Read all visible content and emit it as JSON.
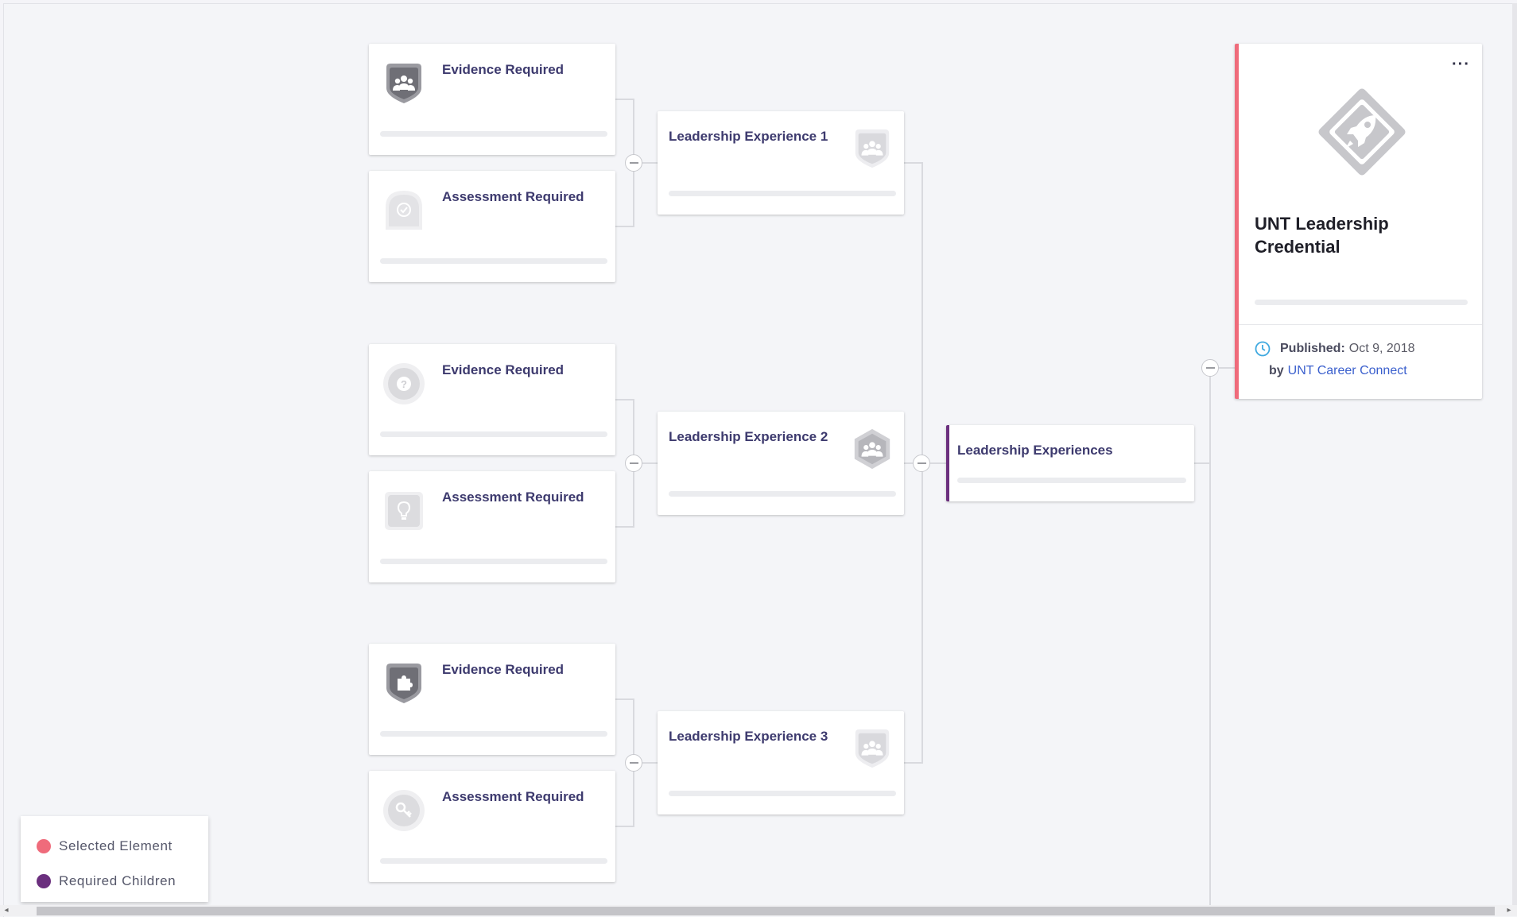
{
  "tree": {
    "groups": [
      {
        "children": [
          {
            "label": "Evidence Required",
            "icon": "group-shield-icon"
          },
          {
            "label": "Assessment Required",
            "icon": "check-arch-icon"
          }
        ],
        "experience": {
          "label": "Leadership Experience 1",
          "icon": "group-shield-icon"
        }
      },
      {
        "children": [
          {
            "label": "Evidence Required",
            "icon": "question-circle-icon"
          },
          {
            "label": "Assessment Required",
            "icon": "lightbulb-square-icon"
          }
        ],
        "experience": {
          "label": "Leadership Experience 2",
          "icon": "group-hexagon-icon"
        }
      },
      {
        "children": [
          {
            "label": "Evidence Required",
            "icon": "puzzle-shield-icon"
          },
          {
            "label": "Assessment Required",
            "icon": "key-circle-icon"
          }
        ],
        "experience": {
          "label": "Leadership Experience 3",
          "icon": "group-shield-icon"
        }
      }
    ],
    "parent": {
      "label": "Leadership Experiences"
    }
  },
  "credential": {
    "title": "UNT Leadership Credential",
    "more_label": "···",
    "published_label": "Published:",
    "published_date": "Oct 9, 2018",
    "by_label": "by",
    "publisher": "UNT Career Connect",
    "icon": "rocket-diamond-icon"
  },
  "legend": {
    "items": [
      {
        "label": "Selected Element",
        "color": "#ef6b7b"
      },
      {
        "label": "Required Children",
        "color": "#6b2f7e"
      }
    ]
  },
  "colors": {
    "accent_selected": "#ef6b7b",
    "accent_required": "#6b2f7e",
    "title_text": "#3d3a6e",
    "link": "#3a5fcd"
  }
}
